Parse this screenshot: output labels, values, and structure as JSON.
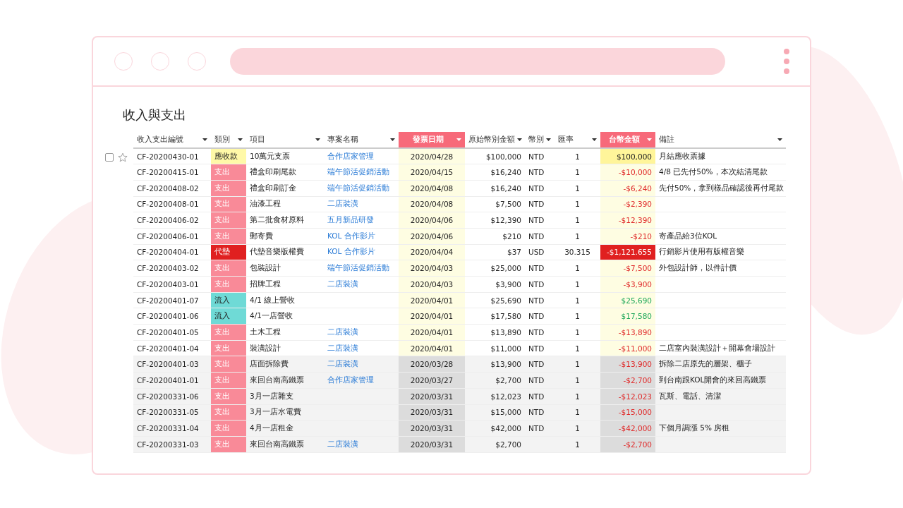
{
  "title": "收入與支出",
  "row_tools": {
    "checked": false,
    "starred": false
  },
  "columns": [
    {
      "label": "收入支出編號",
      "highlighted": false
    },
    {
      "label": "類別",
      "highlighted": false
    },
    {
      "label": "項目",
      "highlighted": false
    },
    {
      "label": "專案名稱",
      "highlighted": false
    },
    {
      "label": "發票日期",
      "highlighted": true
    },
    {
      "label": "原始幣別金額",
      "highlighted": false
    },
    {
      "label": "幣別",
      "highlighted": false
    },
    {
      "label": "匯率",
      "highlighted": false
    },
    {
      "label": "台幣金額",
      "highlighted": true
    },
    {
      "label": "備註",
      "highlighted": false
    }
  ],
  "rows": [
    {
      "greyed": false,
      "id": "CF-20200430-01",
      "category": {
        "text": "應收款",
        "color": "#fff9a8"
      },
      "item": "10萬元支票",
      "project": "合作店家管理",
      "date": "2020/04/28",
      "amount": "$100,000",
      "currency": "NTD",
      "rate": "1",
      "twd": {
        "text": "$100,000",
        "color": "#222222",
        "fill": {
          "color": "#fff59a"
        }
      },
      "note": "月結應收票據"
    },
    {
      "greyed": false,
      "id": "CF-20200415-01",
      "category": {
        "text": "支出",
        "color": "#f98a98"
      },
      "item": "禮盒印刷尾款",
      "project": "端午節活促銷活動",
      "date": "2020/04/15",
      "amount": "$16,240",
      "currency": "NTD",
      "rate": "1",
      "twd": {
        "text": "-$10,000",
        "color": "#e02b2b"
      },
      "note": "4/8 已先付50%，本次結清尾款"
    },
    {
      "greyed": false,
      "id": "CF-20200408-02",
      "category": {
        "text": "支出",
        "color": "#f98a98"
      },
      "item": "禮盒印刷訂金",
      "project": "端午節活促銷活動",
      "date": "2020/04/08",
      "amount": "$16,240",
      "currency": "NTD",
      "rate": "1",
      "twd": {
        "text": "-$6,240",
        "color": "#e02b2b"
      },
      "note": "先付50%，拿到樣品確認後再付尾款"
    },
    {
      "greyed": false,
      "id": "CF-20200408-01",
      "category": {
        "text": "支出",
        "color": "#f98a98"
      },
      "item": "油漆工程",
      "project": "二店裝潢",
      "date": "2020/04/08",
      "amount": "$7,500",
      "currency": "NTD",
      "rate": "1",
      "twd": {
        "text": "-$2,390",
        "color": "#e02b2b"
      }
    },
    {
      "greyed": false,
      "id": "CF-20200406-02",
      "category": {
        "text": "支出",
        "color": "#f98a98"
      },
      "item": "第二批食材原料",
      "project": "五月新品研發",
      "date": "2020/04/06",
      "amount": "$12,390",
      "currency": "NTD",
      "rate": "1",
      "twd": {
        "text": "-$12,390",
        "color": "#e02b2b"
      }
    },
    {
      "greyed": false,
      "id": "CF-20200406-01",
      "category": {
        "text": "支出",
        "color": "#f98a98"
      },
      "item": "郵寄費",
      "project": "KOL 合作影片",
      "date": "2020/04/06",
      "amount": "$210",
      "currency": "NTD",
      "rate": "1",
      "twd": {
        "text": "-$210",
        "color": "#e02b2b"
      },
      "note": "寄產品給3位KOL"
    },
    {
      "greyed": false,
      "id": "CF-20200404-01",
      "category": {
        "text": "代墊",
        "color": "#e02020"
      },
      "item": "代墊音樂版權費",
      "project": "KOL 合作影片",
      "date": "2020/04/04",
      "amount": "$37",
      "currency": "USD",
      "rate": "30.315",
      "twd": {
        "text": "-$1,121.655",
        "color": "#ffffff",
        "fill": {
          "color": "#e02020"
        }
      },
      "note": "行銷影片使用有版權音樂"
    },
    {
      "greyed": false,
      "id": "CF-20200403-02",
      "category": {
        "text": "支出",
        "color": "#f98a98"
      },
      "item": "包裝設計",
      "project": "端午節活促銷活動",
      "date": "2020/04/03",
      "amount": "$25,000",
      "currency": "NTD",
      "rate": "1",
      "twd": {
        "text": "-$7,500",
        "color": "#e02b2b"
      },
      "note": "外包設計師，以件計價"
    },
    {
      "greyed": false,
      "id": "CF-20200403-01",
      "category": {
        "text": "支出",
        "color": "#f98a98"
      },
      "item": "招牌工程",
      "project": "二店裝潢",
      "date": "2020/04/03",
      "amount": "$3,900",
      "currency": "NTD",
      "rate": "1",
      "twd": {
        "text": "-$3,900",
        "color": "#e02b2b"
      }
    },
    {
      "greyed": false,
      "id": "CF-20200401-07",
      "category": {
        "text": "流入",
        "color": "#6fdad6"
      },
      "item": "4/1 線上營收",
      "date": "2020/04/01",
      "amount": "$25,690",
      "currency": "NTD",
      "rate": "1",
      "twd": {
        "text": "$25,690",
        "color": "#1fa85a"
      }
    },
    {
      "greyed": false,
      "id": "CF-20200401-06",
      "category": {
        "text": "流入",
        "color": "#6fdad6"
      },
      "item": "4/1一店營收",
      "date": "2020/04/01",
      "amount": "$17,580",
      "currency": "NTD",
      "rate": "1",
      "twd": {
        "text": "$17,580",
        "color": "#1fa85a"
      }
    },
    {
      "greyed": false,
      "id": "CF-20200401-05",
      "category": {
        "text": "支出",
        "color": "#f98a98"
      },
      "item": "土木工程",
      "project": "二店裝潢",
      "date": "2020/04/01",
      "amount": "$13,890",
      "currency": "NTD",
      "rate": "1",
      "twd": {
        "text": "-$13,890",
        "color": "#e02b2b"
      }
    },
    {
      "greyed": false,
      "id": "CF-20200401-04",
      "category": {
        "text": "支出",
        "color": "#f98a98"
      },
      "item": "裝潢設計",
      "project": "二店裝潢",
      "date": "2020/04/01",
      "amount": "$11,000",
      "currency": "NTD",
      "rate": "1",
      "twd": {
        "text": "-$11,000",
        "color": "#e02b2b"
      },
      "note": "二店室內裝潢設計＋開幕會場設計"
    },
    {
      "greyed": true,
      "id": "CF-20200401-03",
      "category": {
        "text": "支出",
        "color": "#f98a98"
      },
      "item": "店面拆除費",
      "project": "二店裝潢",
      "date": "2020/03/28",
      "amount": "$13,900",
      "currency": "NTD",
      "rate": "1",
      "twd": {
        "text": "-$13,900",
        "color": "#e02b2b"
      },
      "note": "拆除二店原先的層架、櫃子"
    },
    {
      "greyed": true,
      "id": "CF-20200401-01",
      "category": {
        "text": "支出",
        "color": "#f98a98"
      },
      "item": "來回台南高鐵票",
      "project": "合作店家管理",
      "date": "2020/03/27",
      "amount": "$2,700",
      "currency": "NTD",
      "rate": "1",
      "twd": {
        "text": "-$2,700",
        "color": "#e02b2b"
      },
      "note": "到台南跟KOL開會的來回高鐵票"
    },
    {
      "greyed": true,
      "id": "CF-20200331-06",
      "category": {
        "text": "支出",
        "color": "#f98a98"
      },
      "item": "3月一店雜支",
      "date": "2020/03/31",
      "amount": "$12,023",
      "currency": "NTD",
      "rate": "1",
      "twd": {
        "text": "-$12,023",
        "color": "#e02b2b"
      },
      "note": "瓦斯、電話、清潔"
    },
    {
      "greyed": true,
      "id": "CF-20200331-05",
      "category": {
        "text": "支出",
        "color": "#f98a98"
      },
      "item": "3月一店水電費",
      "date": "2020/03/31",
      "amount": "$15,000",
      "currency": "NTD",
      "rate": "1",
      "twd": {
        "text": "-$15,000",
        "color": "#e02b2b"
      }
    },
    {
      "greyed": true,
      "id": "CF-20200331-04",
      "category": {
        "text": "支出",
        "color": "#f98a98"
      },
      "item": "4月一店租金",
      "date": "2020/03/31",
      "amount": "$42,000",
      "currency": "NTD",
      "rate": "1",
      "twd": {
        "text": "-$42,000",
        "color": "#e02b2b"
      },
      "note": "下個月調漲 5% 房租"
    },
    {
      "greyed": true,
      "id": "CF-20200331-03",
      "category": {
        "text": "支出",
        "color": "#f98a98"
      },
      "item": "來回台南高鐵票",
      "project": "二店裝潢",
      "date": "2020/03/31",
      "amount": "$2,700",
      "rate": "1",
      "twd": {
        "text": "-$2,700",
        "color": "#e02b2b"
      }
    }
  ]
}
